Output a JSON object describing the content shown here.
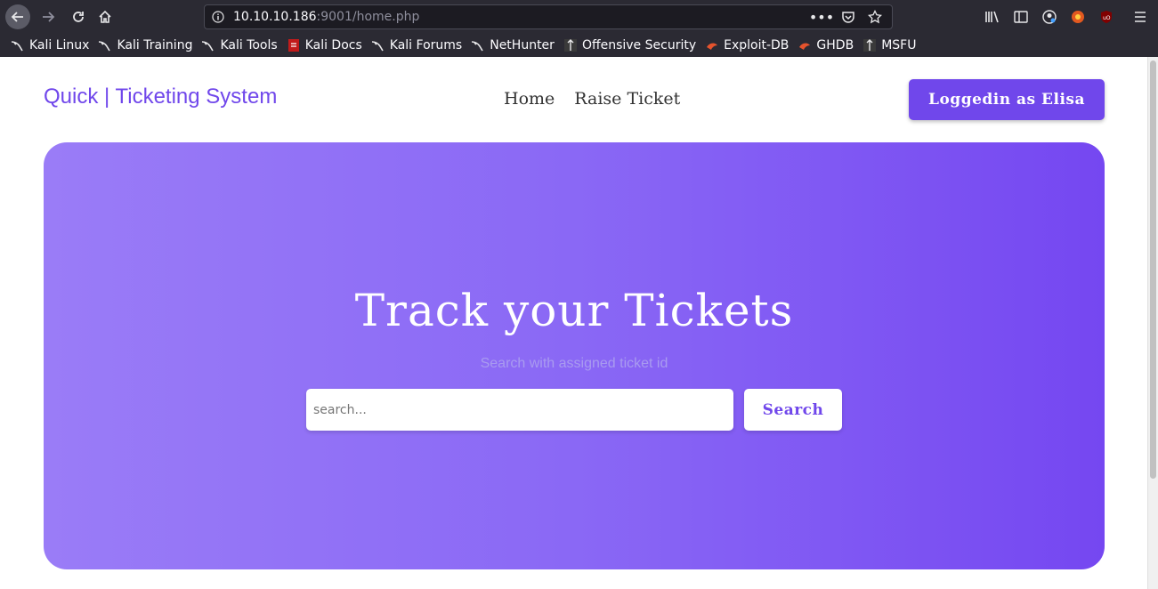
{
  "browser": {
    "url_host": "10.10.10.186",
    "url_rest": ":9001/home.php",
    "bookmarks": [
      {
        "label": "Kali Linux",
        "icon": "kali-dragon-icon"
      },
      {
        "label": "Kali Training",
        "icon": "kali-dragon-icon"
      },
      {
        "label": "Kali Tools",
        "icon": "kali-dragon-icon"
      },
      {
        "label": "Kali Docs",
        "icon": "kali-docs-icon"
      },
      {
        "label": "Kali Forums",
        "icon": "kali-dragon-icon"
      },
      {
        "label": "NetHunter",
        "icon": "kali-dragon-icon"
      },
      {
        "label": "Offensive Security",
        "icon": "offsec-icon"
      },
      {
        "label": "Exploit-DB",
        "icon": "exploitdb-icon"
      },
      {
        "label": "GHDB",
        "icon": "exploitdb-icon"
      },
      {
        "label": "MSFU",
        "icon": "offsec-icon"
      }
    ]
  },
  "site": {
    "brand": "Quick | Ticketing System",
    "nav": [
      "Home",
      "Raise Ticket"
    ],
    "login_label": "Loggedin as Elisa",
    "accent": "#7047eb"
  },
  "hero": {
    "title": "Track your Tickets",
    "subtitle": "Search with assigned ticket id",
    "search_placeholder": "search...",
    "search_button": "Search"
  }
}
